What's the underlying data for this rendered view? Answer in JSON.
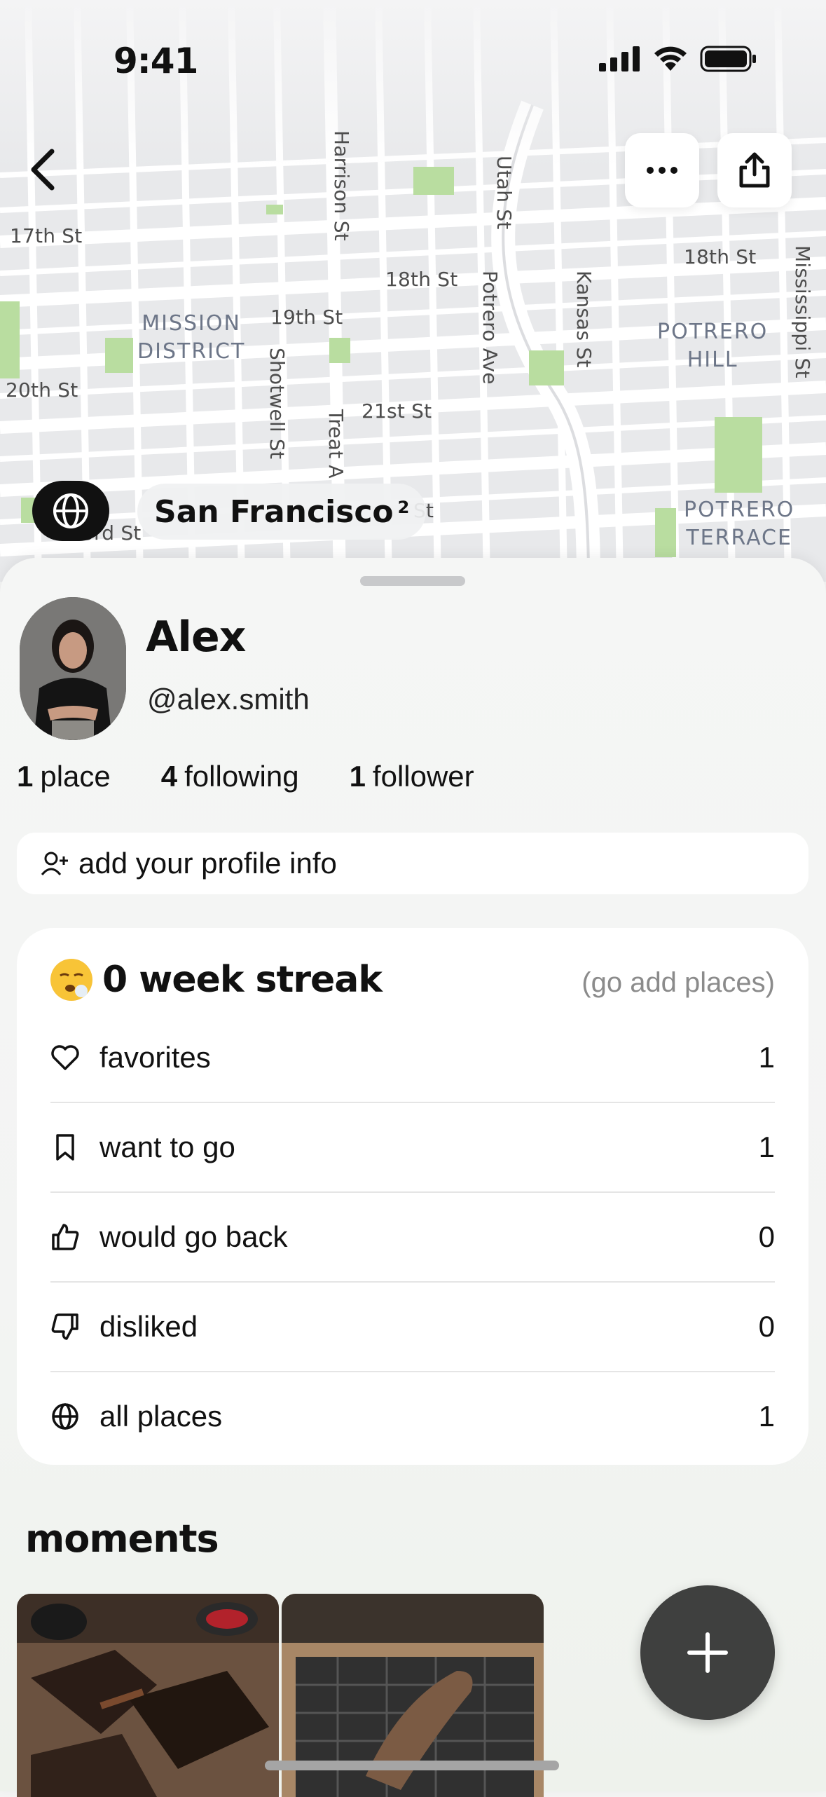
{
  "status_bar": {
    "time": "9:41"
  },
  "map": {
    "streets": [
      "17th St",
      "18th St",
      "18th St",
      "19th St",
      "20th St",
      "21st St",
      "23rd St",
      "St",
      "Harrison St",
      "Shotwell St",
      "Treat A",
      "Potrero Ave",
      "Kansas St",
      "Utah St",
      "Mississippi St",
      "St",
      "St"
    ],
    "districts": [
      {
        "line1": "MISSION",
        "line2": "DISTRICT"
      },
      {
        "line1": "POTRERO",
        "line2": "HILL"
      },
      {
        "line1": "POTRERO",
        "line2": "TERRACE"
      }
    ],
    "city": "San Francisco",
    "city_count": "2"
  },
  "header": {
    "back_icon": "chevron-left-icon",
    "more_icon": "ellipsis-icon",
    "share_icon": "share-icon"
  },
  "profile": {
    "name": "Alex",
    "handle": "@alex.smith",
    "stats": [
      {
        "num": "1",
        "label": "place"
      },
      {
        "num": "4",
        "label": "following"
      },
      {
        "num": "1",
        "label": "follower"
      }
    ],
    "add_info_label": "add your profile info"
  },
  "streak": {
    "title": "0 week streak",
    "cta": "(go add places)",
    "emoji": "tired-face-emoji"
  },
  "lists": [
    {
      "icon": "heart-icon",
      "label": "favorites",
      "count": "1"
    },
    {
      "icon": "bookmark-icon",
      "label": "want to go",
      "count": "1"
    },
    {
      "icon": "thumbs-up-icon",
      "label": "would go back",
      "count": "0"
    },
    {
      "icon": "thumbs-down-icon",
      "label": "disliked",
      "count": "0"
    },
    {
      "icon": "globe-icon",
      "label": "all places",
      "count": "1"
    }
  ],
  "moments": {
    "title": "moments"
  },
  "fab": {
    "icon": "plus-icon"
  }
}
